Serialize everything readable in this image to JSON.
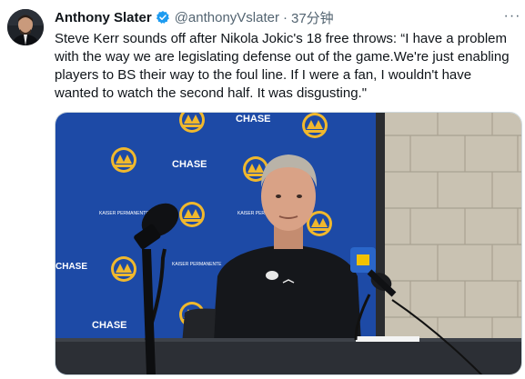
{
  "tweet": {
    "author_name": "Anthony Slater",
    "author_handle": "@anthonyVslater",
    "separator": "·",
    "time": "37分钟",
    "more_label": "···",
    "text": "Steve Kerr sounds off after Nikola Jokic's 18 free throws: “I have a problem with the way we are legislating defense out of the game.We're just enabling players to BS their way to the foul line. If I were a fan, I wouldn't have wanted to watch the second half. It was disgusting.\""
  },
  "media": {
    "backdrop_sponsor": "CHASE",
    "backdrop_team": "WARRIORS",
    "backdrop_partner": "KAISER PERMANENTE",
    "colors": {
      "backdrop_blue": "#1d4aa6",
      "wall": "#c9c2b2",
      "logo_gold": "#f0b82d"
    }
  },
  "colors": {
    "verified": "#1d9bf0",
    "text_secondary": "#536471"
  }
}
